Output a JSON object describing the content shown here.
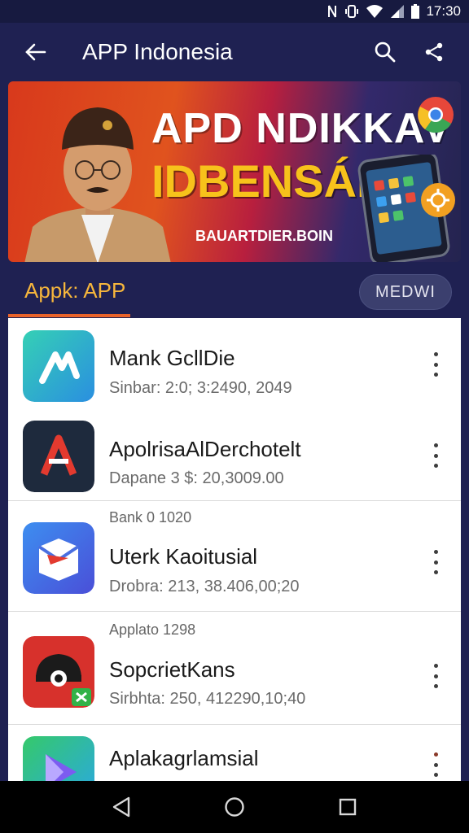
{
  "status_bar": {
    "time": "17:30",
    "icons": [
      "nfc-icon",
      "vibrate-icon",
      "wifi-icon",
      "signal-icon",
      "battery-icon"
    ]
  },
  "app_bar": {
    "title": "APP Indonesia",
    "back_icon": "back-arrow-icon",
    "search_icon": "search-icon",
    "share_icon": "share-icon"
  },
  "banner": {
    "headline_1": "APD NDIKKAV",
    "headline_2": "IDBENSÁI.",
    "subline": "BAUARTDIER.BOIN",
    "colors": {
      "headline_1": "#ffffff",
      "headline_2": "#f7c21b"
    }
  },
  "section": {
    "title": "Appk: APP",
    "button_label": "MEDWI",
    "accent": "#e9632a"
  },
  "apps": [
    {
      "meta": "",
      "name": "Mank GcllDie",
      "detail": "Sinbar: 2:0; 3:2490, 2049",
      "icon": "teal-arrow-app-icon"
    },
    {
      "meta": "",
      "name": "ApolrisaAlDerchotelt",
      "detail": "Dapane 3 $: 20,3009.00",
      "icon": "red-a-app-icon"
    },
    {
      "meta": "Bank 0 1020",
      "name": "Uterk Kaoitusial",
      "detail": "Drobra: 213, 38.406,00;20",
      "icon": "blue-envelope-app-icon"
    },
    {
      "meta": "Applato 1298",
      "name": "SopcrietKans",
      "detail": "Sirbhta: 250, 412290,10;40",
      "icon": "red-helmet-app-icon"
    },
    {
      "meta": "",
      "name": "Aplakagrlamsial",
      "detail": "",
      "icon": "play-triangle-app-icon"
    }
  ],
  "nav": {
    "back": "nav-back-icon",
    "home": "nav-home-icon",
    "recents": "nav-recents-icon"
  }
}
